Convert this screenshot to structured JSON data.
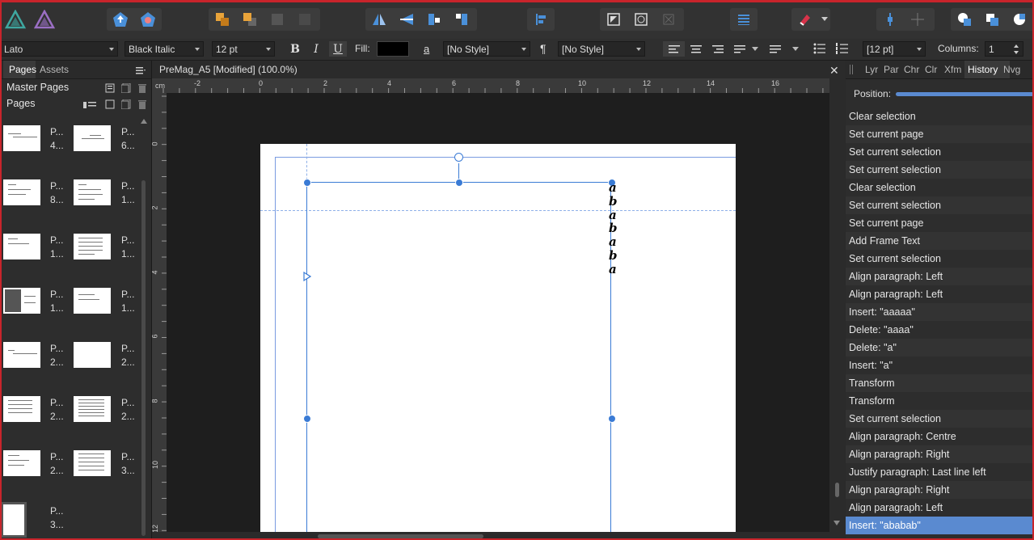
{
  "toolbar": {
    "icons": [
      "affinity-designer-icon",
      "affinity-photo-icon",
      "export-persona-icon",
      "share-persona-icon",
      "arrange-back-icon",
      "arrange-front-icon",
      "group-icon",
      "ungroup-icon",
      "flip-horizontal-icon",
      "flip-vertical-icon",
      "rotate-left-icon",
      "rotate-right-icon",
      "align-left-icon",
      "text-wrap-icon",
      "frame-icon",
      "close-frame-icon",
      "baseline-grid-icon",
      "snapping-magnet-icon",
      "boolean-add-icon",
      "boolean-subtract-icon",
      "boolean-intersect-icon"
    ]
  },
  "context": {
    "font_family": "Lato",
    "font_style": "Black Italic",
    "font_size": "12 pt",
    "bold": "B",
    "italic": "I",
    "underline": "U",
    "fill_label": "Fill:",
    "char_style": "[No Style]",
    "para_style": "[No Style]",
    "leading": "[12 pt]",
    "columns_label": "Columns:",
    "columns_value": "1"
  },
  "left_panel": {
    "tabs": [
      "Pages",
      "Assets"
    ],
    "master_pages_label": "Master Pages",
    "pages_label": "Pages",
    "pages": [
      {
        "label1": "P...",
        "label2": "4..."
      },
      {
        "label1": "P...",
        "label2": "6..."
      },
      {
        "label1": "P...",
        "label2": "8..."
      },
      {
        "label1": "P...",
        "label2": "1..."
      },
      {
        "label1": "P...",
        "label2": "1..."
      },
      {
        "label1": "P...",
        "label2": "1..."
      },
      {
        "label1": "P...",
        "label2": "1..."
      },
      {
        "label1": "P...",
        "label2": "1..."
      },
      {
        "label1": "P...",
        "label2": "2..."
      },
      {
        "label1": "P...",
        "label2": "2..."
      },
      {
        "label1": "P...",
        "label2": "2..."
      },
      {
        "label1": "P...",
        "label2": "2..."
      },
      {
        "label1": "P...",
        "label2": "2..."
      },
      {
        "label1": "P...",
        "label2": "3..."
      },
      {
        "label1": "P...",
        "label2": "3..."
      }
    ]
  },
  "document": {
    "tab_title": "PreMag_A5 [Modified] (100.0%)",
    "ruler_unit": "cm",
    "ruler_top": [
      "-2",
      "0",
      "2",
      "4",
      "6",
      "8",
      "10",
      "12",
      "14",
      "16"
    ],
    "ruler_left": [
      "0",
      "2",
      "4",
      "6",
      "8",
      "10",
      "12"
    ],
    "text_content": [
      "a",
      "b",
      "a",
      "b",
      "a",
      "b",
      "a"
    ]
  },
  "right_panel": {
    "tabs": [
      "Lyr",
      "Par",
      "Chr",
      "Clr",
      "Xfm",
      "History",
      "Nvg"
    ],
    "active_tab": "History",
    "position_label": "Position:",
    "history": [
      "Clear selection",
      "Set current page",
      "Set current selection",
      "Set current selection",
      "Clear selection",
      "Set current selection",
      "Set current page",
      "Add Frame Text",
      "Set current selection",
      "Align paragraph: Left",
      "Align paragraph: Left",
      "Insert: \"aaaaa\"",
      "Delete: \"aaaa\"",
      "Delete: \"a\"",
      "Insert: \"a\"",
      "Transform",
      "Transform",
      "Set current selection",
      "Align paragraph: Centre",
      "Align paragraph: Right",
      "Justify paragraph: Last line left",
      "Align paragraph: Right",
      "Align paragraph: Left",
      "Insert: \"ababab\""
    ]
  },
  "colors": {
    "accent": "#5a8ad0",
    "frame_border": "#c8242b",
    "selection_blue": "#3a7bd5"
  }
}
